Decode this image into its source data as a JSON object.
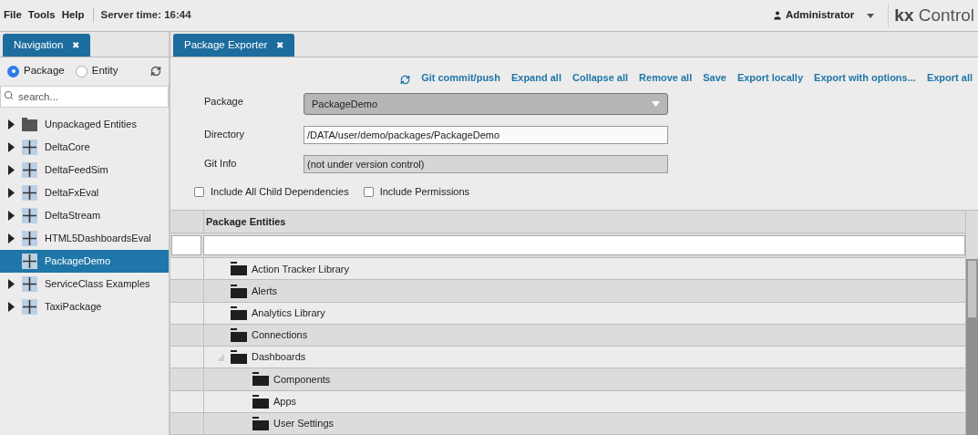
{
  "menu": [
    "File",
    "Tools",
    "Help"
  ],
  "server_time": "Server time: 16:44",
  "user": "Administrator",
  "logo": {
    "strong": "kx",
    "rest": "Control"
  },
  "nav_panel": {
    "tab": {
      "label": "Navigation",
      "close": "✖",
      "selected": true
    },
    "mode": [
      {
        "label": "Package",
        "selected": true
      },
      {
        "label": "Entity",
        "selected": false
      }
    ],
    "search": {
      "placeholder": "search..."
    },
    "items": [
      {
        "label": "Unpackaged Entities",
        "kind": "folder",
        "expanded": false,
        "selected": false
      },
      {
        "label": "DeltaCore",
        "kind": "package",
        "expanded": false,
        "selected": false
      },
      {
        "label": "DeltaFeedSim",
        "kind": "package",
        "expanded": false,
        "selected": false
      },
      {
        "label": "DeltaFxEval",
        "kind": "package",
        "expanded": false,
        "selected": false
      },
      {
        "label": "DeltaStream",
        "kind": "package",
        "expanded": false,
        "selected": false
      },
      {
        "label": "HTML5DashboardsEval",
        "kind": "package",
        "expanded": false,
        "selected": false
      },
      {
        "label": "PackageDemo",
        "kind": "package",
        "selected": true
      },
      {
        "label": "ServiceClass Examples",
        "kind": "package",
        "expanded": false,
        "selected": false
      },
      {
        "label": "TaxiPackage",
        "kind": "package",
        "expanded": false,
        "selected": false
      }
    ]
  },
  "exporter": {
    "tab": {
      "label": "Package Exporter",
      "close": "✖",
      "selected": true
    },
    "actions": [
      "Git commit/push",
      "Expand all",
      "Collapse all",
      "Remove all",
      "Save",
      "Export locally",
      "Export with options...",
      "Export all"
    ],
    "fields": [
      {
        "label": "Package",
        "kind": "select",
        "value": "PackageDemo"
      },
      {
        "label": "Directory",
        "kind": "input",
        "value": "/DATA/user/demo/packages/PackageDemo"
      },
      {
        "label": "Git Info",
        "kind": "readonly",
        "value": "(not under version control)"
      }
    ],
    "options": [
      {
        "label": "Include All Child Dependencies",
        "checked": false
      },
      {
        "label": "Include Permissions",
        "checked": false
      }
    ],
    "table": {
      "columns": [
        "Package Entities"
      ],
      "rows": [
        {
          "label": "Action Tracker Library"
        },
        {
          "label": "Alerts"
        },
        {
          "label": "Analytics Library"
        },
        {
          "label": "Connections"
        },
        {
          "label": "Dashboards",
          "expanded": true,
          "children": [
            {
              "label": "Components"
            },
            {
              "label": "Apps"
            },
            {
              "label": "User Settings"
            }
          ]
        }
      ]
    }
  }
}
